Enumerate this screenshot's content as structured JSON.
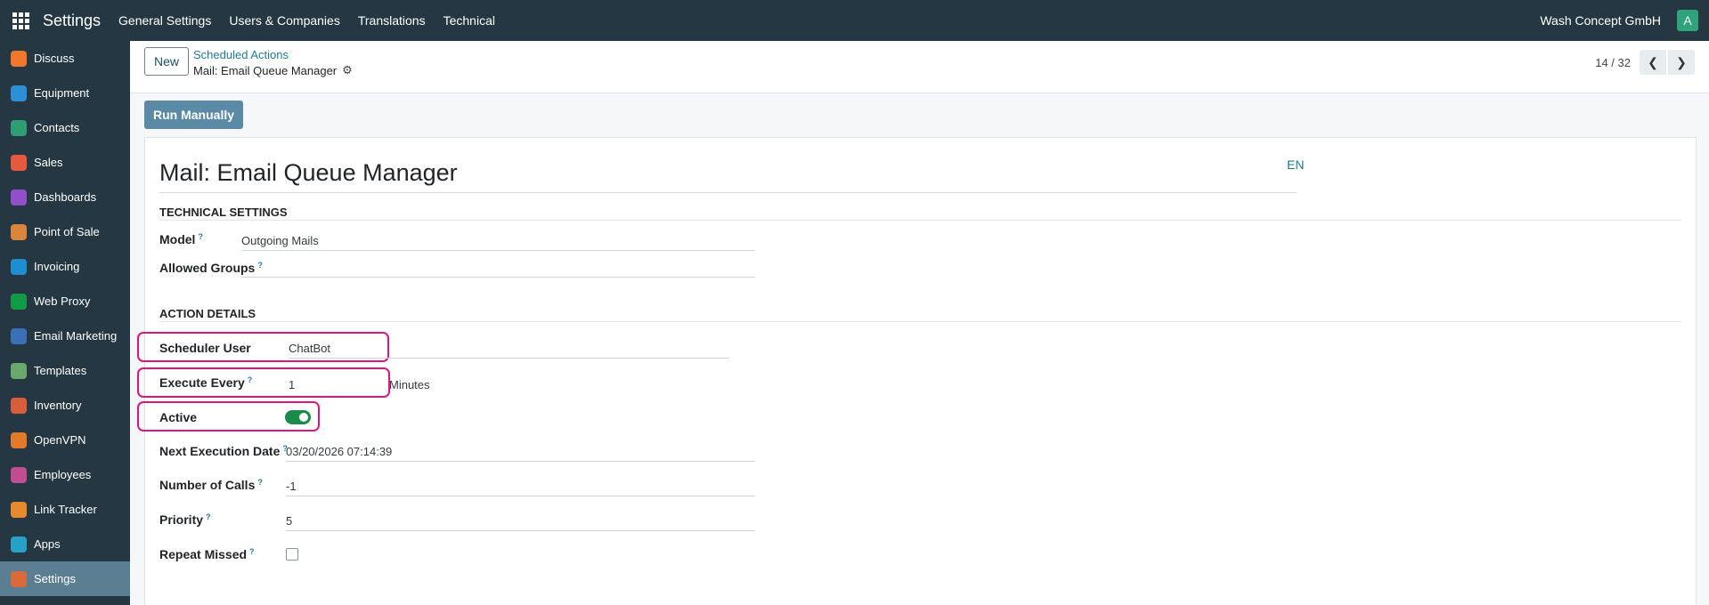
{
  "topbar": {
    "app_name": "Settings",
    "menu": [
      "General Settings",
      "Users & Companies",
      "Translations",
      "Technical"
    ],
    "company": "Wash Concept GmbH",
    "avatar_letter": "A"
  },
  "sidebar": {
    "items": [
      {
        "label": "Discuss",
        "color": "#f0772b"
      },
      {
        "label": "Equipment",
        "color": "#2d8fd6"
      },
      {
        "label": "Contacts",
        "color": "#2f9e74"
      },
      {
        "label": "Sales",
        "color": "#e55a3c"
      },
      {
        "label": "Dashboards",
        "color": "#9150c9"
      },
      {
        "label": "Point of Sale",
        "color": "#d9853b"
      },
      {
        "label": "Invoicing",
        "color": "#1d8fd1"
      },
      {
        "label": "Web Proxy",
        "color": "#119b46"
      },
      {
        "label": "Email Marketing",
        "color": "#3b6fb6"
      },
      {
        "label": "Templates",
        "color": "#6aa96e"
      },
      {
        "label": "Inventory",
        "color": "#d85e3a"
      },
      {
        "label": "OpenVPN",
        "color": "#e17a2b"
      },
      {
        "label": "Employees",
        "color": "#c04d8f"
      },
      {
        "label": "Link Tracker",
        "color": "#e58b2e"
      },
      {
        "label": "Apps",
        "color": "#27a1c8"
      },
      {
        "label": "Settings",
        "color": "#d96a3b"
      }
    ],
    "active": "Settings"
  },
  "control": {
    "new_label": "New",
    "breadcrumb_parent": "Scheduled Actions",
    "breadcrumb_current": "Mail: Email Queue Manager",
    "pager": "14 / 32"
  },
  "form": {
    "run_label": "Run Manually",
    "title": "Mail: Email Queue Manager",
    "lang": "EN",
    "technical_section": "TECHNICAL SETTINGS",
    "model_label": "Model",
    "model_value": "Outgoing Mails",
    "groups_label": "Allowed Groups",
    "groups_value": "",
    "action_section": "ACTION DETAILS",
    "user_label": "Scheduler User",
    "user_value": "ChatBot",
    "every_label": "Execute Every",
    "every_value": "1",
    "every_unit": "Minutes",
    "active_label": "Active",
    "active_value": true,
    "next_label": "Next Execution Date",
    "next_value": "03/20/2026 07:14:39",
    "calls_label": "Number of Calls",
    "calls_value": "-1",
    "priority_label": "Priority",
    "priority_value": "5",
    "repeat_label": "Repeat Missed",
    "repeat_value": false
  },
  "colors": {
    "navbar": "#243742",
    "highlight": "#e0147d",
    "toggle_on": "#1c8a4a",
    "link": "#1f7a99"
  }
}
